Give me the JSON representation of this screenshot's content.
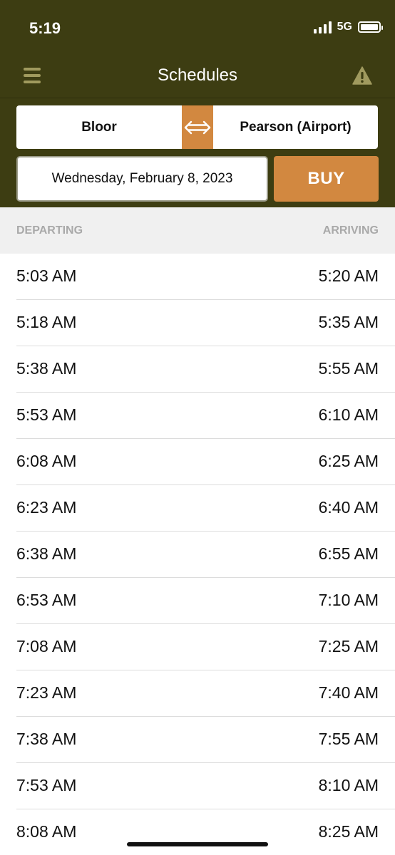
{
  "status_bar": {
    "time": "5:19",
    "network": "5G"
  },
  "navbar": {
    "title": "Schedules"
  },
  "route": {
    "from": "Bloor",
    "to": "Pearson (Airport)"
  },
  "date": "Wednesday, February 8, 2023",
  "buy_label": "BUY",
  "columns": {
    "departing": "DEPARTING",
    "arriving": "ARRIVING"
  },
  "trips": [
    {
      "departing": "5:03 AM",
      "arriving": "5:20 AM"
    },
    {
      "departing": "5:18 AM",
      "arriving": "5:35 AM"
    },
    {
      "departing": "5:38 AM",
      "arriving": "5:55 AM"
    },
    {
      "departing": "5:53 AM",
      "arriving": "6:10 AM"
    },
    {
      "departing": "6:08 AM",
      "arriving": "6:25 AM"
    },
    {
      "departing": "6:23 AM",
      "arriving": "6:40 AM"
    },
    {
      "departing": "6:38 AM",
      "arriving": "6:55 AM"
    },
    {
      "departing": "6:53 AM",
      "arriving": "7:10 AM"
    },
    {
      "departing": "7:08 AM",
      "arriving": "7:25 AM"
    },
    {
      "departing": "7:23 AM",
      "arriving": "7:40 AM"
    },
    {
      "departing": "7:38 AM",
      "arriving": "7:55 AM"
    },
    {
      "departing": "7:53 AM",
      "arriving": "8:10 AM"
    },
    {
      "departing": "8:08 AM",
      "arriving": "8:25 AM"
    }
  ],
  "colors": {
    "header_bg": "#3d3d12",
    "accent": "#d28840",
    "icon_muted": "#a09a5e"
  },
  "icons": {
    "menu": "hamburger-icon",
    "alert": "warning-icon",
    "swap": "swap-arrows-icon"
  }
}
